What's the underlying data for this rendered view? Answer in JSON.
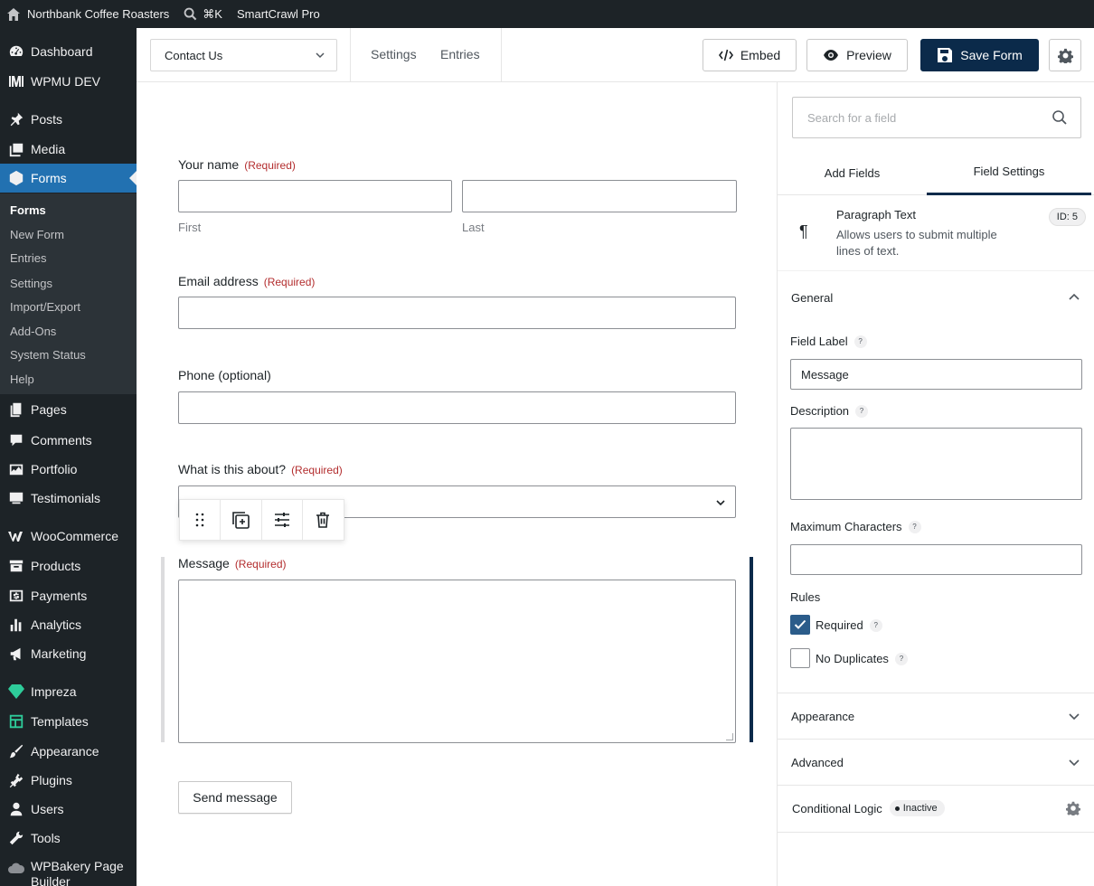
{
  "admin_bar": {
    "site_name": "Northbank Coffee Roasters",
    "search_shortcut": "⌘K",
    "plugin": "SmartCrawl Pro"
  },
  "sidebar": {
    "items": [
      {
        "label": "Dashboard",
        "icon": "dashboard-icon"
      },
      {
        "label": "WPMU DEV",
        "icon": "wpmudev-icon"
      },
      {
        "label": "Posts",
        "icon": "pin-icon"
      },
      {
        "label": "Media",
        "icon": "media-icon"
      },
      {
        "label": "Forms",
        "icon": "forms-icon",
        "active": true
      },
      {
        "label": "Pages",
        "icon": "pages-icon"
      },
      {
        "label": "Comments",
        "icon": "comment-icon"
      },
      {
        "label": "Portfolio",
        "icon": "portfolio-icon"
      },
      {
        "label": "Testimonials",
        "icon": "testimonials-icon"
      },
      {
        "label": "WooCommerce",
        "icon": "woocommerce-icon"
      },
      {
        "label": "Products",
        "icon": "archive-icon"
      },
      {
        "label": "Payments",
        "icon": "dollar-icon"
      },
      {
        "label": "Analytics",
        "icon": "bar-chart-icon"
      },
      {
        "label": "Marketing",
        "icon": "megaphone-icon"
      },
      {
        "label": "Impreza",
        "icon": "diamond-icon"
      },
      {
        "label": "Templates",
        "icon": "templates-icon"
      },
      {
        "label": "Appearance",
        "icon": "brush-icon"
      },
      {
        "label": "Plugins",
        "icon": "plug-icon"
      },
      {
        "label": "Users",
        "icon": "user-icon"
      },
      {
        "label": "Tools",
        "icon": "wrench-icon"
      },
      {
        "label": "WPBakery Page Builder",
        "icon": "cloud-icon"
      }
    ],
    "submenu": [
      "Forms",
      "New Form",
      "Entries",
      "Settings",
      "Import/Export",
      "Add-Ons",
      "System Status",
      "Help"
    ]
  },
  "form_bar": {
    "form_select": "Contact Us",
    "settings_link": "Settings",
    "entries_link": "Entries",
    "embed": "Embed",
    "preview": "Preview",
    "save": "Save Form"
  },
  "canvas": {
    "required": "(Required)",
    "name_label": "Your name",
    "first": "First",
    "last": "Last",
    "email_label": "Email address",
    "phone_label": "Phone (optional)",
    "about_label": "What is this about?",
    "message_label": "Message",
    "send": "Send message"
  },
  "panel": {
    "search_placeholder": "Search for a field",
    "tab_add": "Add Fields",
    "tab_settings": "Field Settings",
    "field_title": "Paragraph Text",
    "field_desc": "Allows users to submit multiple lines of text.",
    "field_id": "ID: 5",
    "general": "General",
    "field_label_label": "Field Label",
    "field_label_value": "Message",
    "description_label": "Description",
    "max_chars_label": "Maximum Characters",
    "rules_label": "Rules",
    "required_label": "Required",
    "required_checked": true,
    "no_dup_label": "No Duplicates",
    "no_dup_checked": false,
    "appearance": "Appearance",
    "advanced": "Advanced",
    "conditional_logic": "Conditional Logic",
    "inactive": "Inactive",
    "help_mark": "?"
  },
  "colors": {
    "admin_dark": "#1d2327",
    "active_blue": "#2271b1",
    "primary_navy": "#0b2a4a",
    "required_red": "#b32d2e"
  }
}
